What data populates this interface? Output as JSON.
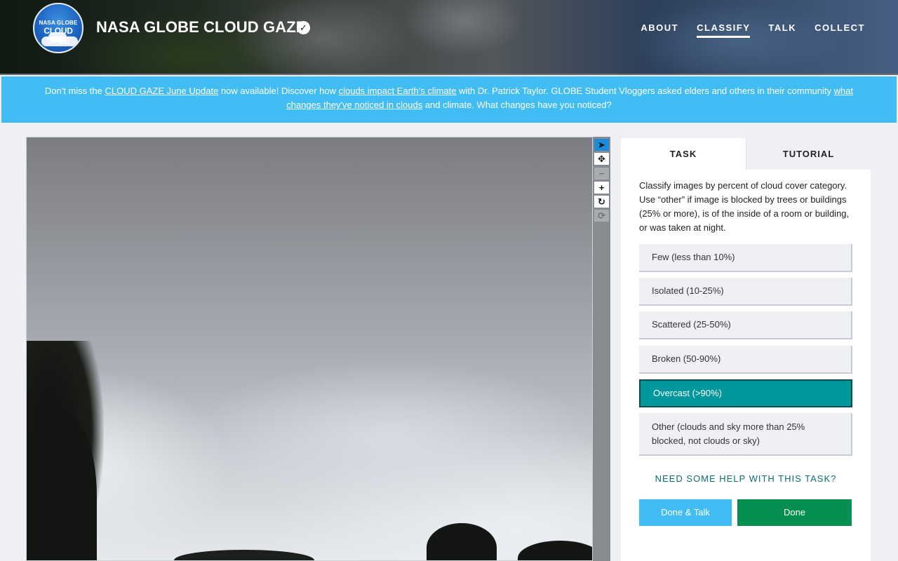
{
  "header": {
    "logo_line1": "NASA GLOBE",
    "logo_line2": "CLOUD GAZE",
    "title": "NASA GLOBE CLOUD GAZE",
    "nav": [
      {
        "label": "ABOUT"
      },
      {
        "label": "CLASSIFY"
      },
      {
        "label": "TALK"
      },
      {
        "label": "COLLECT"
      }
    ]
  },
  "banner": {
    "t1": "Don't miss the ",
    "link1": "CLOUD GAZE June Update",
    "t2": " now available! Discover how ",
    "link2": "clouds impact Earth's climate",
    "t3": " with Dr. Patrick Taylor. GLOBE Student Vloggers asked elders and others in their community ",
    "link3": "what changes they've noticed in clouds",
    "t4": " and climate. What changes have you noticed?"
  },
  "panel": {
    "tabs": [
      {
        "label": "TASK"
      },
      {
        "label": "TUTORIAL"
      }
    ],
    "instructions": "Classify images by percent of cloud cover category. Use “other” if image is blocked by trees or buildings (25% or more), is of the inside of a room or building, or was taken at night.",
    "choices": [
      {
        "label": "Few (less than 10%)"
      },
      {
        "label": "Isolated (10-25%)"
      },
      {
        "label": "Scattered (25-50%)"
      },
      {
        "label": "Broken (50-90%)"
      },
      {
        "label": "Overcast (>90%)"
      },
      {
        "label": "Other (clouds and sky more than 25% blocked, not clouds or sky)"
      }
    ],
    "help": "NEED SOME HELP WITH THIS TASK?",
    "done_talk": "Done & Talk",
    "done": "Done"
  },
  "icons": {
    "verified": "check-circle-icon",
    "tools": [
      "pointer-icon",
      "move-icon",
      "zoom-out-icon",
      "zoom-in-icon",
      "rotate-icon",
      "reset-icon"
    ]
  },
  "colors": {
    "banner": "#42bdf3",
    "selected_choice": "#00979d",
    "done_button": "#078f52",
    "help_text": "#0a6e73"
  }
}
